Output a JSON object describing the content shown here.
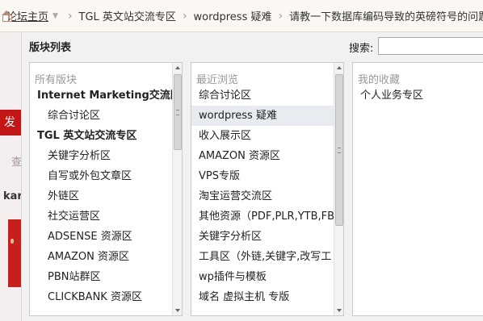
{
  "breadcrumb": {
    "home": "论坛主页",
    "items": [
      "TGL 英文站交流专区",
      "wordpress 疑难",
      "请教一下数据库编码导致的英磅符号的问题"
    ]
  },
  "background": {
    "red_button": "发",
    "text_1": "查",
    "text_2": "kar"
  },
  "panel": {
    "title": "版块列表",
    "search_label": "搜索:",
    "search_placeholder": ""
  },
  "columns": {
    "all": {
      "header": "所有版块",
      "items": [
        {
          "label": "Internet Marketing交流区",
          "group": true
        },
        {
          "label": "综合讨论区",
          "group": false
        },
        {
          "label": "TGL 英文站交流专区",
          "group": true
        },
        {
          "label": "关键字分析区",
          "group": false
        },
        {
          "label": "自写或外包文章区",
          "group": false
        },
        {
          "label": "外链区",
          "group": false
        },
        {
          "label": "社交运营区",
          "group": false
        },
        {
          "label": "ADSENSE 资源区",
          "group": false
        },
        {
          "label": "AMAZON 资源区",
          "group": false
        },
        {
          "label": "PBN站群区",
          "group": false
        },
        {
          "label": "CLICKBANK 资源区",
          "group": false
        }
      ]
    },
    "recent": {
      "header": "最近浏览",
      "items": [
        {
          "label": "综合讨论区",
          "active": false
        },
        {
          "label": "wordpress 疑难",
          "active": true
        },
        {
          "label": "收入展示区",
          "active": false
        },
        {
          "label": "AMAZON 资源区",
          "active": false
        },
        {
          "label": "VPS专版",
          "active": false
        },
        {
          "label": "淘宝运营交流区",
          "active": false
        },
        {
          "label": "其他资源（PDF,PLR,YTB,FB",
          "active": false
        },
        {
          "label": "关键字分析区",
          "active": false
        },
        {
          "label": "工具区（外链,关键字,改写工",
          "active": false
        },
        {
          "label": "wp插件与模板",
          "active": false
        },
        {
          "label": "域名 虚拟主机 专版",
          "active": false
        }
      ]
    },
    "favorites": {
      "header": "我的收藏",
      "items": [
        {
          "label": "个人业务专区"
        }
      ]
    }
  },
  "colors": {
    "panel_bg": "#f1f1f1",
    "active_row": "#e8ecf1",
    "accent_red": "#c31717"
  }
}
